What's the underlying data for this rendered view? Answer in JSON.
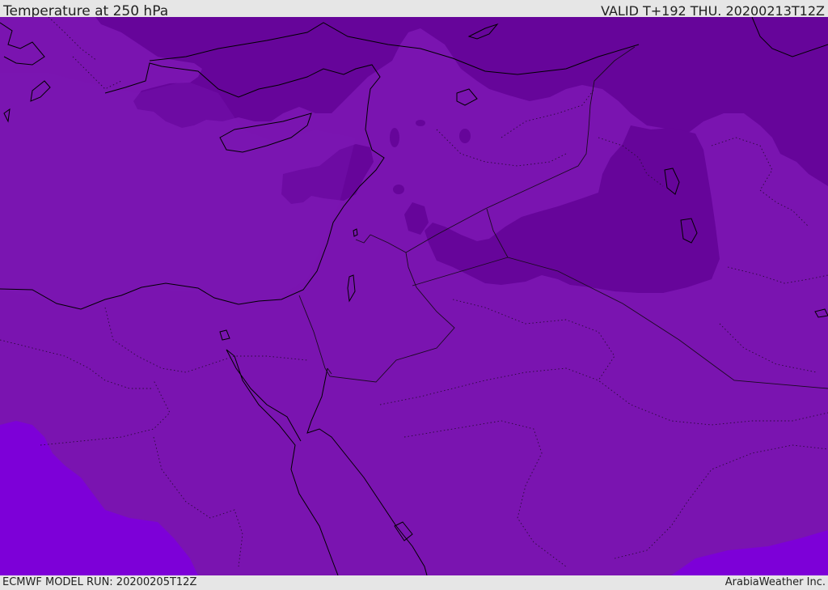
{
  "header": {
    "title": "Temperature at 250 hPa",
    "valid": "VALID T+192 THU. 20200213T12Z"
  },
  "footer": {
    "model_run": "ECMWF MODEL RUN: 20200205T12Z",
    "credit": "ArabiaWeather Inc."
  },
  "colors": {
    "band_mid": "#7a14b0",
    "band_cold": "#66059a",
    "band_warm": "#7d00d8",
    "coastline": "#000000",
    "border": "#1a0a20",
    "bar": "#e6e6e6"
  }
}
